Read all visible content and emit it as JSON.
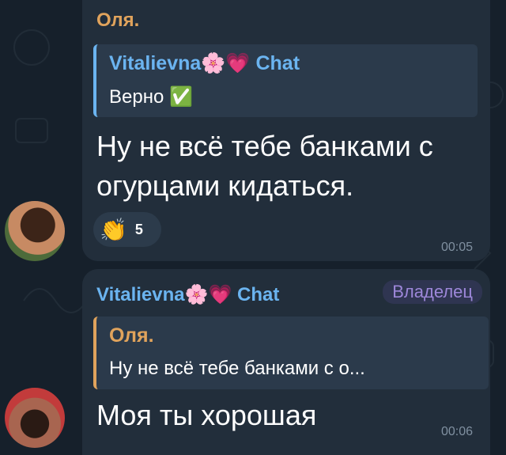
{
  "messages": [
    {
      "sender": "Оля.",
      "reply": {
        "author": "Vitalievna🌸💗 Chat",
        "text": "Верно ✅"
      },
      "text": "Ну не всё тебе банками с огурцами кидаться.",
      "reaction": {
        "emoji": "👏",
        "count": "5"
      },
      "time": "00:05"
    },
    {
      "sender": "Vitalievna🌸💗 Chat",
      "badge": "Владелец",
      "reply": {
        "author": "Оля.",
        "text": "Ну не всё тебе банками с о..."
      },
      "text": "Моя ты хорошая",
      "time": "00:06"
    }
  ]
}
